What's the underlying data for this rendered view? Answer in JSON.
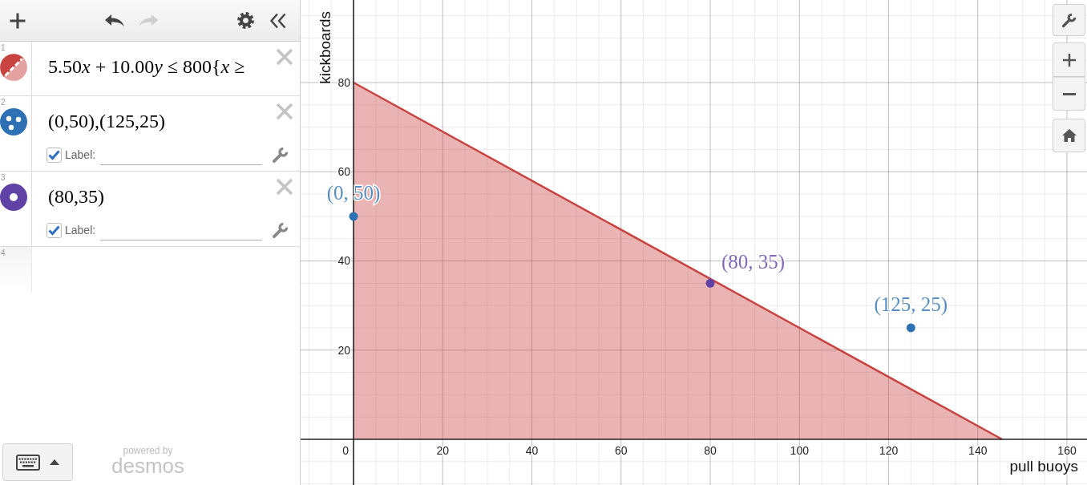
{
  "toolbar": {
    "buttons": [
      {
        "kind": "add",
        "disabled": false
      },
      {
        "kind": "undo",
        "disabled": false
      },
      {
        "kind": "redo",
        "disabled": true
      },
      {
        "kind": "settings",
        "disabled": false
      },
      {
        "kind": "collapse",
        "disabled": false
      }
    ]
  },
  "expressions": [
    {
      "number": "1",
      "kind": "inequality",
      "color": "#c74440",
      "expression": [
        {
          "text": "5.50",
          "italic": false
        },
        {
          "text": "x",
          "italic": true
        },
        {
          "text": " + 10.00",
          "italic": false
        },
        {
          "text": "y",
          "italic": true
        },
        {
          "text": " ≤ 800{",
          "italic": false
        },
        {
          "text": "x",
          "italic": true
        },
        {
          "text": " ≥",
          "italic": false
        }
      ]
    },
    {
      "number": "2",
      "kind": "points",
      "color": "#2d70b3",
      "expression": [
        {
          "text": "(0,50),(125,25)",
          "italic": false
        }
      ],
      "label": {
        "checked": true,
        "caption": "Label:"
      }
    },
    {
      "number": "3",
      "kind": "point",
      "color": "#6042a6",
      "expression": [
        {
          "text": "(80,35)",
          "italic": false
        }
      ],
      "label": {
        "checked": true,
        "caption": "Label:"
      }
    },
    {
      "number": "4",
      "kind": "empty"
    }
  ],
  "branding": {
    "caption": "powered by",
    "logo": "desmos"
  },
  "graph": {
    "origin_label": "0",
    "chart_data": {
      "type": "area",
      "grid": true,
      "xlabel": "pull buoys",
      "ylabel": "kickboards",
      "xlim": [
        -11.87,
        164.49
      ],
      "ylim": [
        -10.25,
        98.52
      ],
      "xticks": [
        20,
        40,
        60,
        80,
        100,
        120,
        140,
        160
      ],
      "yticks": [
        20,
        40,
        60,
        80
      ],
      "series": [
        {
          "color": "#c74440",
          "x": [
            0,
            145.45
          ],
          "values": [
            80,
            0
          ]
        },
        {
          "type": "scatter",
          "color": "#2d70b3",
          "x": [
            0,
            125
          ],
          "values": [
            50,
            25
          ]
        },
        {
          "type": "scatter",
          "color": "#6042a6",
          "x": [
            80
          ],
          "values": [
            35
          ]
        }
      ],
      "annotations": [
        {
          "text": "(0, 50)",
          "x": 0,
          "y": 50
        },
        {
          "text": "(125, 25)",
          "x": 125,
          "y": 25
        },
        {
          "text": "(80, 35)",
          "x": 80,
          "y": 35
        }
      ]
    }
  }
}
